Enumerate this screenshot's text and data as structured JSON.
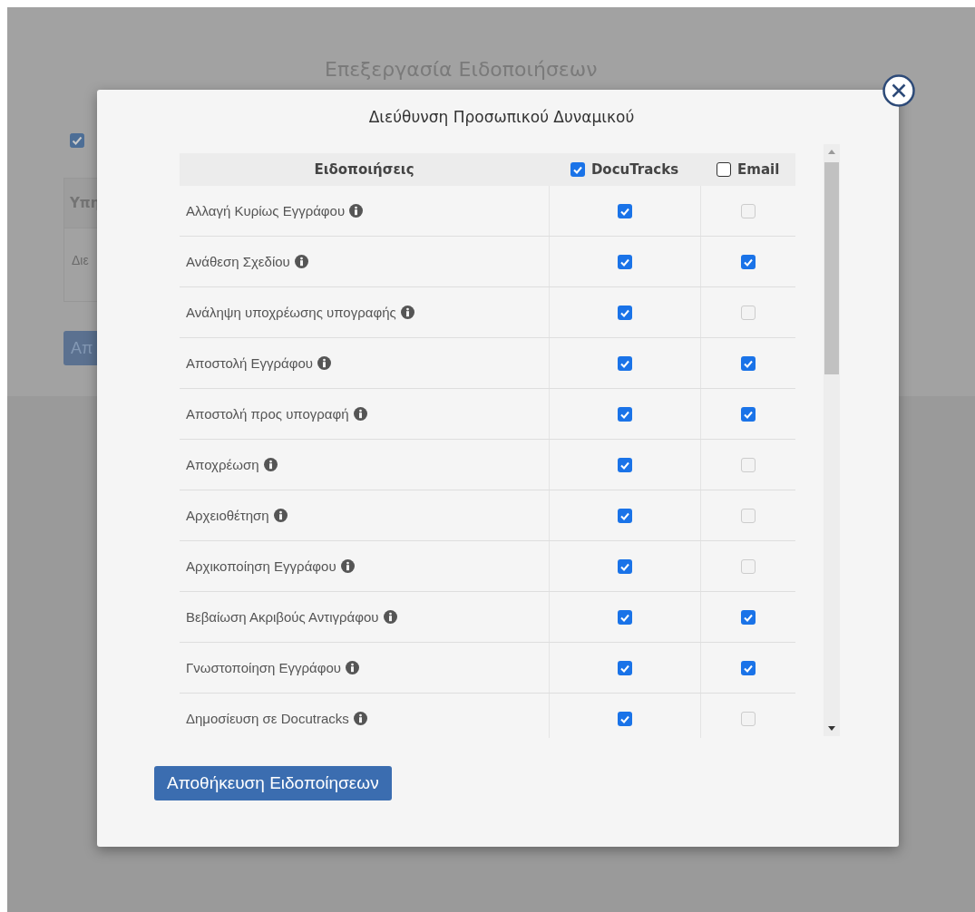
{
  "page": {
    "title": "Επεξεργασία Ειδοποιήσεων",
    "checkbox": {
      "checked": true
    },
    "table": {
      "header": "Υπη",
      "cell": "Διε"
    },
    "button": "Απ"
  },
  "dialog": {
    "title": "Διεύθυνση Προσωπικού Δυναμικού",
    "columns": [
      {
        "label": "Ειδοποιήσεις",
        "kind": "text"
      },
      {
        "label": "DocuTracks",
        "kind": "check",
        "checked": true
      },
      {
        "label": "Email",
        "kind": "check",
        "checked": false
      }
    ],
    "rows": [
      {
        "name": "Αλλαγή Κυρίως Εγγράφου",
        "docutracks": true,
        "email": false
      },
      {
        "name": "Ανάθεση Σχεδίου",
        "docutracks": true,
        "email": true
      },
      {
        "name": "Ανάληψη υποχρέωσης υπογραφής",
        "docutracks": true,
        "email": false
      },
      {
        "name": "Αποστολή Εγγράφου",
        "docutracks": true,
        "email": true
      },
      {
        "name": "Αποστολή προς υπογραφή",
        "docutracks": true,
        "email": true
      },
      {
        "name": "Αποχρέωση",
        "docutracks": true,
        "email": false
      },
      {
        "name": "Αρχειοθέτηση",
        "docutracks": true,
        "email": false
      },
      {
        "name": "Αρχικοποίηση Εγγράφου",
        "docutracks": true,
        "email": false
      },
      {
        "name": "Βεβαίωση Ακριβούς Αντιγράφου",
        "docutracks": true,
        "email": true
      },
      {
        "name": "Γνωστοποίηση Εγγράφου",
        "docutracks": true,
        "email": true
      },
      {
        "name": "Δημοσίευση σε Docutracks",
        "docutracks": true,
        "email": false
      }
    ],
    "save_button": "Αποθήκευση Ειδοποίησεων"
  }
}
